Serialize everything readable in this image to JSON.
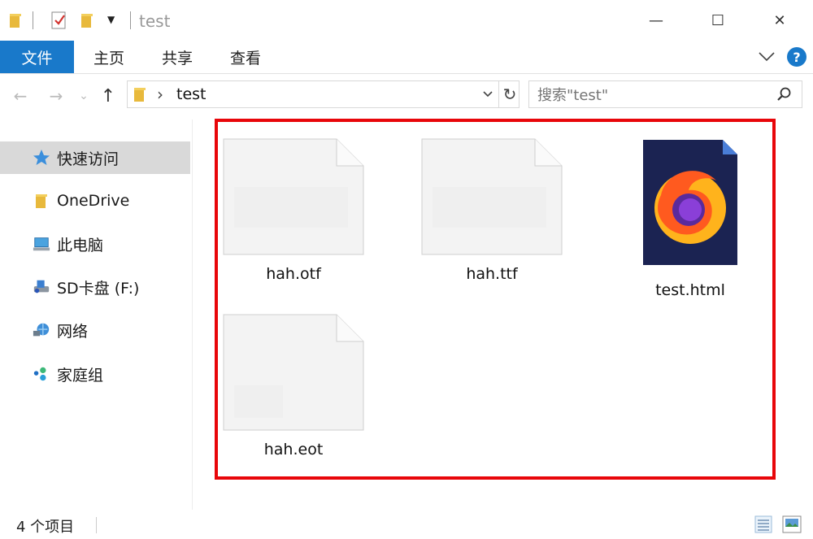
{
  "window": {
    "title": "test",
    "minimize_glyph": "—",
    "maximize_glyph": "☐",
    "close_glyph": "✕"
  },
  "ribbon": {
    "tabs": [
      {
        "label": "文件",
        "active": true
      },
      {
        "label": "主页",
        "active": false
      },
      {
        "label": "共享",
        "active": false
      },
      {
        "label": "查看",
        "active": false
      }
    ],
    "help_label": "?"
  },
  "nav": {
    "back_glyph": "←",
    "forward_glyph": "→",
    "recent_glyph": "⌄",
    "up_glyph": "↑",
    "breadcrumb_sep": "›",
    "path": "test",
    "refresh_glyph": "↻",
    "search_placeholder": "搜索\"test\""
  },
  "sidebar": {
    "items": [
      {
        "label": "快速访问",
        "icon": "star-icon",
        "selected": true
      },
      {
        "label": "OneDrive",
        "icon": "folder-icon",
        "selected": false
      },
      {
        "label": "此电脑",
        "icon": "computer-icon",
        "selected": false
      },
      {
        "label": "SD卡盘 (F:)",
        "icon": "drive-icon",
        "selected": false
      },
      {
        "label": "网络",
        "icon": "network-icon",
        "selected": false
      },
      {
        "label": "家庭组",
        "icon": "homegroup-icon",
        "selected": false
      }
    ]
  },
  "files": [
    {
      "name": "hah.otf",
      "icon": "font-file-icon"
    },
    {
      "name": "hah.ttf",
      "icon": "font-file-icon"
    },
    {
      "name": "test.html",
      "icon": "firefox-html-icon"
    },
    {
      "name": "hah.eot",
      "icon": "font-file-icon"
    }
  ],
  "status": {
    "item_count": "4 个项目"
  },
  "colors": {
    "accent": "#1979ca",
    "highlight": "#e8060a",
    "help": "#1979ca"
  }
}
